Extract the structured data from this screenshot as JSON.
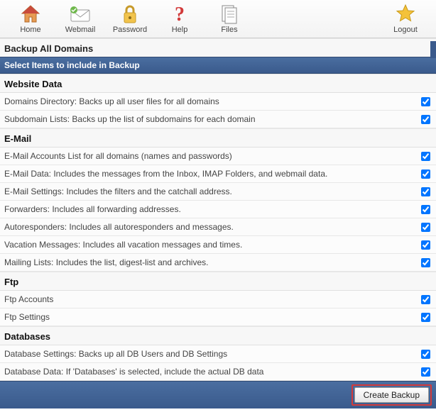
{
  "toolbar": {
    "home": "Home",
    "webmail": "Webmail",
    "password": "Password",
    "help": "Help",
    "files": "Files",
    "logout": "Logout"
  },
  "page_title": "Backup All Domains",
  "section_header": "Select Items to include in Backup",
  "groups": {
    "website": {
      "title": "Website Data",
      "items": [
        "Domains Directory: Backs up all user files for all domains",
        "Subdomain Lists: Backs up the list of subdomains for each domain"
      ]
    },
    "email": {
      "title": "E-Mail",
      "items": [
        "E-Mail Accounts List for all domains (names and passwords)",
        "E-Mail Data: Includes the messages from the Inbox, IMAP Folders, and webmail data.",
        "E-Mail Settings: Includes the filters and the catchall address.",
        "Forwarders: Includes all forwarding addresses.",
        "Autoresponders: Includes all autoresponders and messages.",
        "Vacation Messages: Includes all vacation messages and times.",
        "Mailing Lists: Includes the list, digest-list and archives."
      ]
    },
    "ftp": {
      "title": "Ftp",
      "items": [
        "Ftp Accounts",
        "Ftp Settings"
      ]
    },
    "db": {
      "title": "Databases",
      "items": [
        "Database Settings: Backs up all DB Users and DB Settings",
        "Database Data: If 'Databases' is selected, include the actual DB data"
      ]
    }
  },
  "create_button": "Create Backup"
}
